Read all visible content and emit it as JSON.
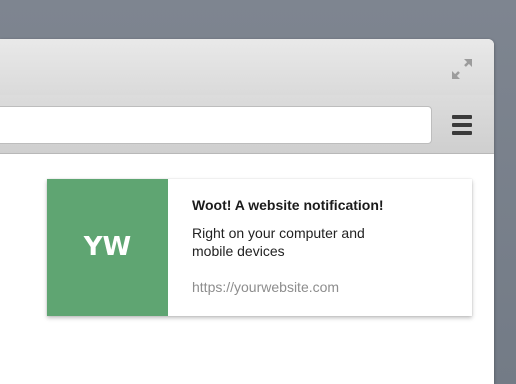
{
  "colors": {
    "backdrop": "#777e89",
    "notification_logo_bg": "#5fa572",
    "notification_title": "#1b1b1b",
    "notification_url": "#8d8d8d"
  },
  "window": {
    "expand_icon": "expand-arrows-icon",
    "menu_icon": "hamburger-menu-icon",
    "address_bar_value": ""
  },
  "notification": {
    "logo_text": "YW",
    "title": "Woot! A website notification!",
    "message": "Right on your computer and mobile devices",
    "url": "https://yourwebsite.com"
  }
}
